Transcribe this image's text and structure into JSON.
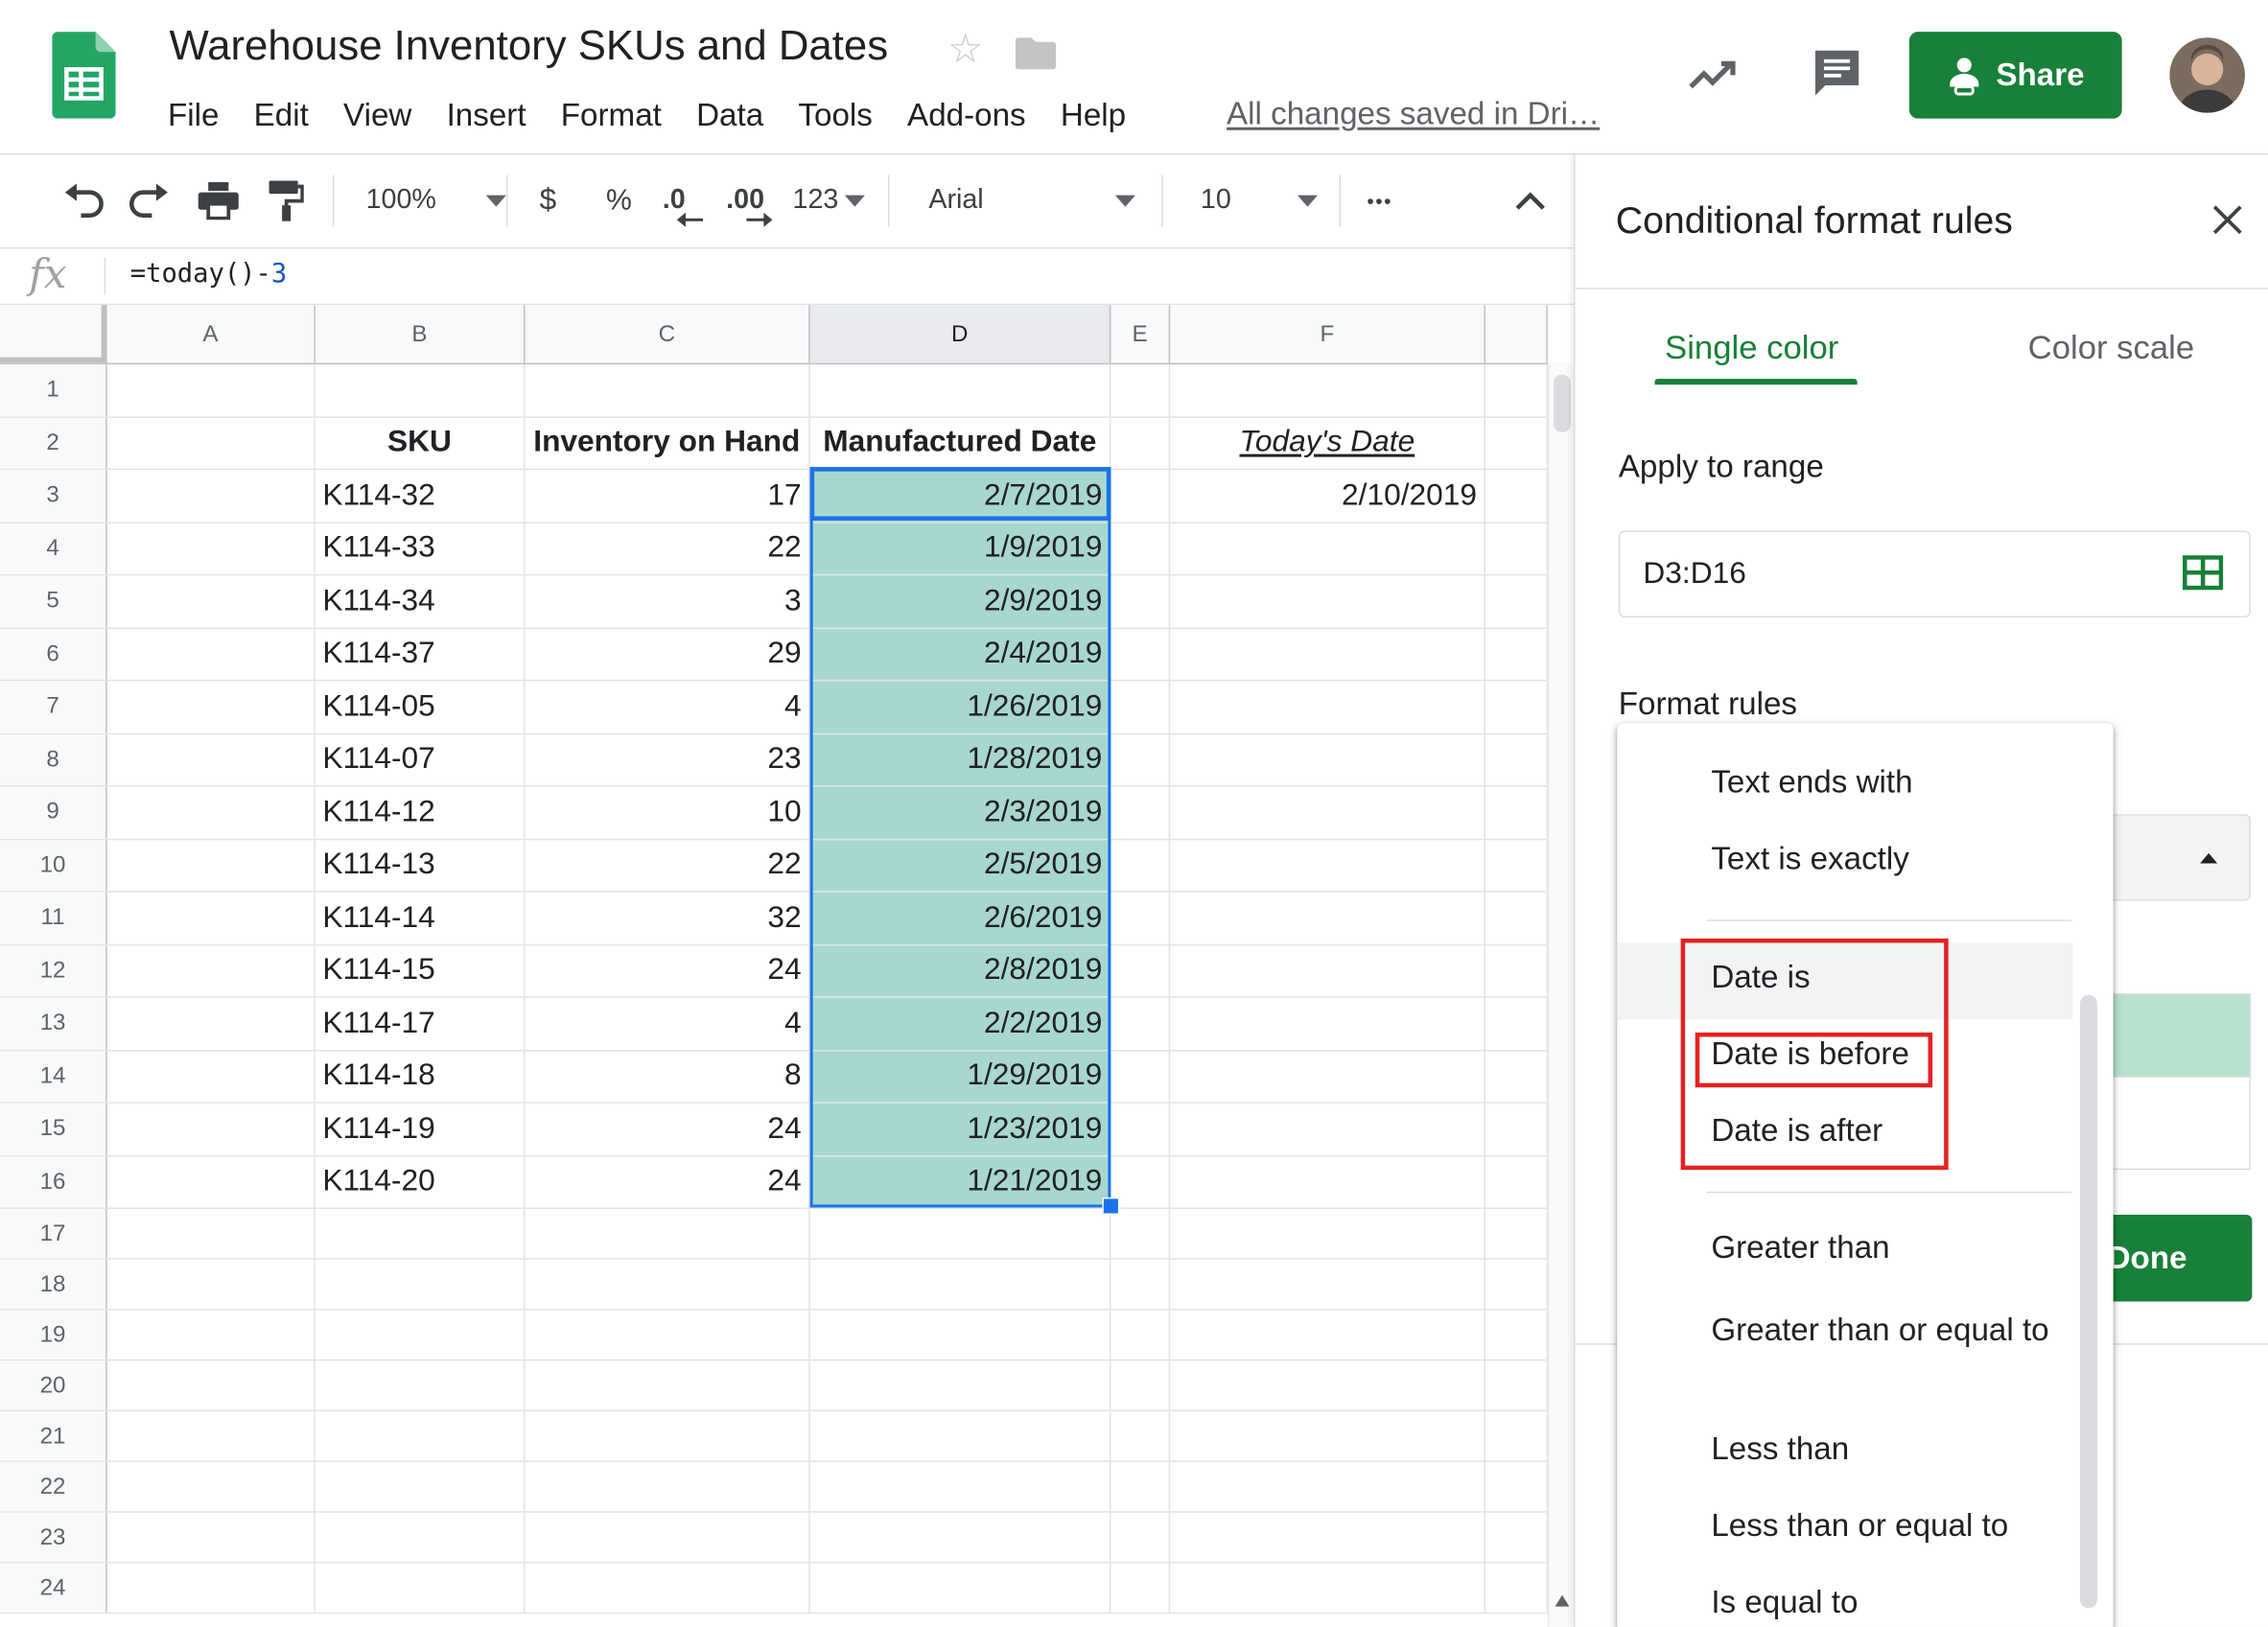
{
  "doc": {
    "title": "Warehouse Inventory SKUs and Dates",
    "saved_status": "All changes saved in Dri…"
  },
  "menu": [
    "File",
    "Edit",
    "View",
    "Insert",
    "Format",
    "Data",
    "Tools",
    "Add-ons",
    "Help"
  ],
  "header": {
    "share_label": "Share",
    "share_color": "#188038"
  },
  "toolbar": {
    "zoom": "100%",
    "currency": "$",
    "percent": "%",
    "decrease_decimals": ".0",
    "increase_decimals": ".00",
    "number_format": "123",
    "font": "Arial",
    "font_size": "10",
    "more": "•••"
  },
  "formula_bar": {
    "fx": "fx",
    "formula_prefix": "=today()-",
    "formula_number": "3"
  },
  "sheet": {
    "columns": [
      "A",
      "B",
      "C",
      "D",
      "E",
      "F"
    ],
    "selected_column": "D",
    "row_numbers": [
      "1",
      "2",
      "3",
      "4",
      "5",
      "6",
      "7",
      "8",
      "9",
      "10",
      "11",
      "12",
      "13",
      "14",
      "15",
      "16",
      "17",
      "18",
      "19",
      "20",
      "21",
      "22",
      "23",
      "24"
    ],
    "headers": {
      "sku": "SKU",
      "inventory": "Inventory on Hand",
      "manufactured": "Manufactured Date",
      "today": "Today's Date"
    },
    "today_value": "2/10/2019",
    "rows": [
      {
        "sku": "K114-32",
        "inv": "17",
        "date": "2/7/2019"
      },
      {
        "sku": "K114-33",
        "inv": "22",
        "date": "1/9/2019"
      },
      {
        "sku": "K114-34",
        "inv": "3",
        "date": "2/9/2019"
      },
      {
        "sku": "K114-37",
        "inv": "29",
        "date": "2/4/2019"
      },
      {
        "sku": "K114-05",
        "inv": "4",
        "date": "1/26/2019"
      },
      {
        "sku": "K114-07",
        "inv": "23",
        "date": "1/28/2019"
      },
      {
        "sku": "K114-12",
        "inv": "10",
        "date": "2/3/2019"
      },
      {
        "sku": "K114-13",
        "inv": "22",
        "date": "2/5/2019"
      },
      {
        "sku": "K114-14",
        "inv": "32",
        "date": "2/6/2019"
      },
      {
        "sku": "K114-15",
        "inv": "24",
        "date": "2/8/2019"
      },
      {
        "sku": "K114-17",
        "inv": "4",
        "date": "2/2/2019"
      },
      {
        "sku": "K114-18",
        "inv": "8",
        "date": "1/29/2019"
      },
      {
        "sku": "K114-19",
        "inv": "24",
        "date": "1/23/2019"
      },
      {
        "sku": "K114-20",
        "inv": "24",
        "date": "1/21/2019"
      }
    ],
    "highlight_color": "#a7d7cf",
    "selection_color": "#1a73e8"
  },
  "panel": {
    "title": "Conditional format rules",
    "tabs": {
      "single": "Single color",
      "scale": "Color scale"
    },
    "apply_label": "Apply to range",
    "range_value": "D3:D16",
    "format_rules_label": "Format rules",
    "done_label": "Done",
    "preview_color": "#b7e1cd"
  },
  "dropdown": {
    "items": [
      "Text ends with",
      "Text is exactly",
      "Date is",
      "Date is before",
      "Date is after",
      "Greater than",
      "Greater than or equal to",
      "Less than",
      "Less than or equal to",
      "Is equal to"
    ],
    "annotation_color": "#e5201f"
  }
}
